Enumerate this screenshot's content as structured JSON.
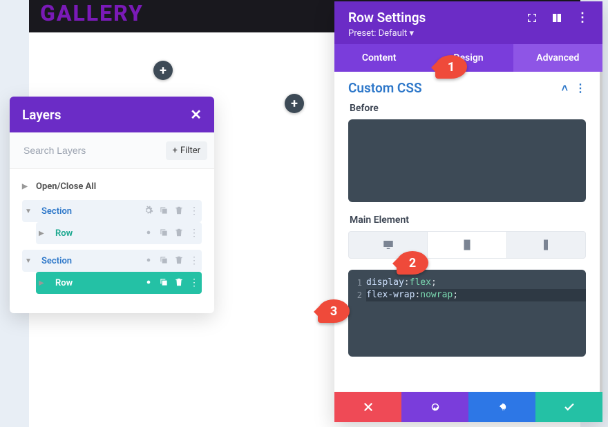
{
  "page": {
    "gallery_label": "GALLERY"
  },
  "layers": {
    "title": "Layers",
    "search_placeholder": "Search Layers",
    "filter_label": "Filter",
    "toggle_all": "Open/Close All",
    "items": [
      {
        "label": "Section"
      },
      {
        "label": "Row"
      },
      {
        "label": "Section"
      },
      {
        "label": "Row"
      }
    ]
  },
  "settings": {
    "title": "Row Settings",
    "preset": "Preset: Default",
    "tabs": {
      "content": "Content",
      "design": "Design",
      "advanced": "Advanced"
    },
    "section": "Custom CSS",
    "before_label": "Before",
    "main_label": "Main Element",
    "code": {
      "l1_prop": "display",
      "l1_val": "flex",
      "l2_prop": "flex-wrap",
      "l2_val": "nowrap",
      "l1_num": "1",
      "l2_num": "2"
    }
  },
  "callouts": {
    "c1": "1",
    "c2": "2",
    "c3": "3"
  }
}
